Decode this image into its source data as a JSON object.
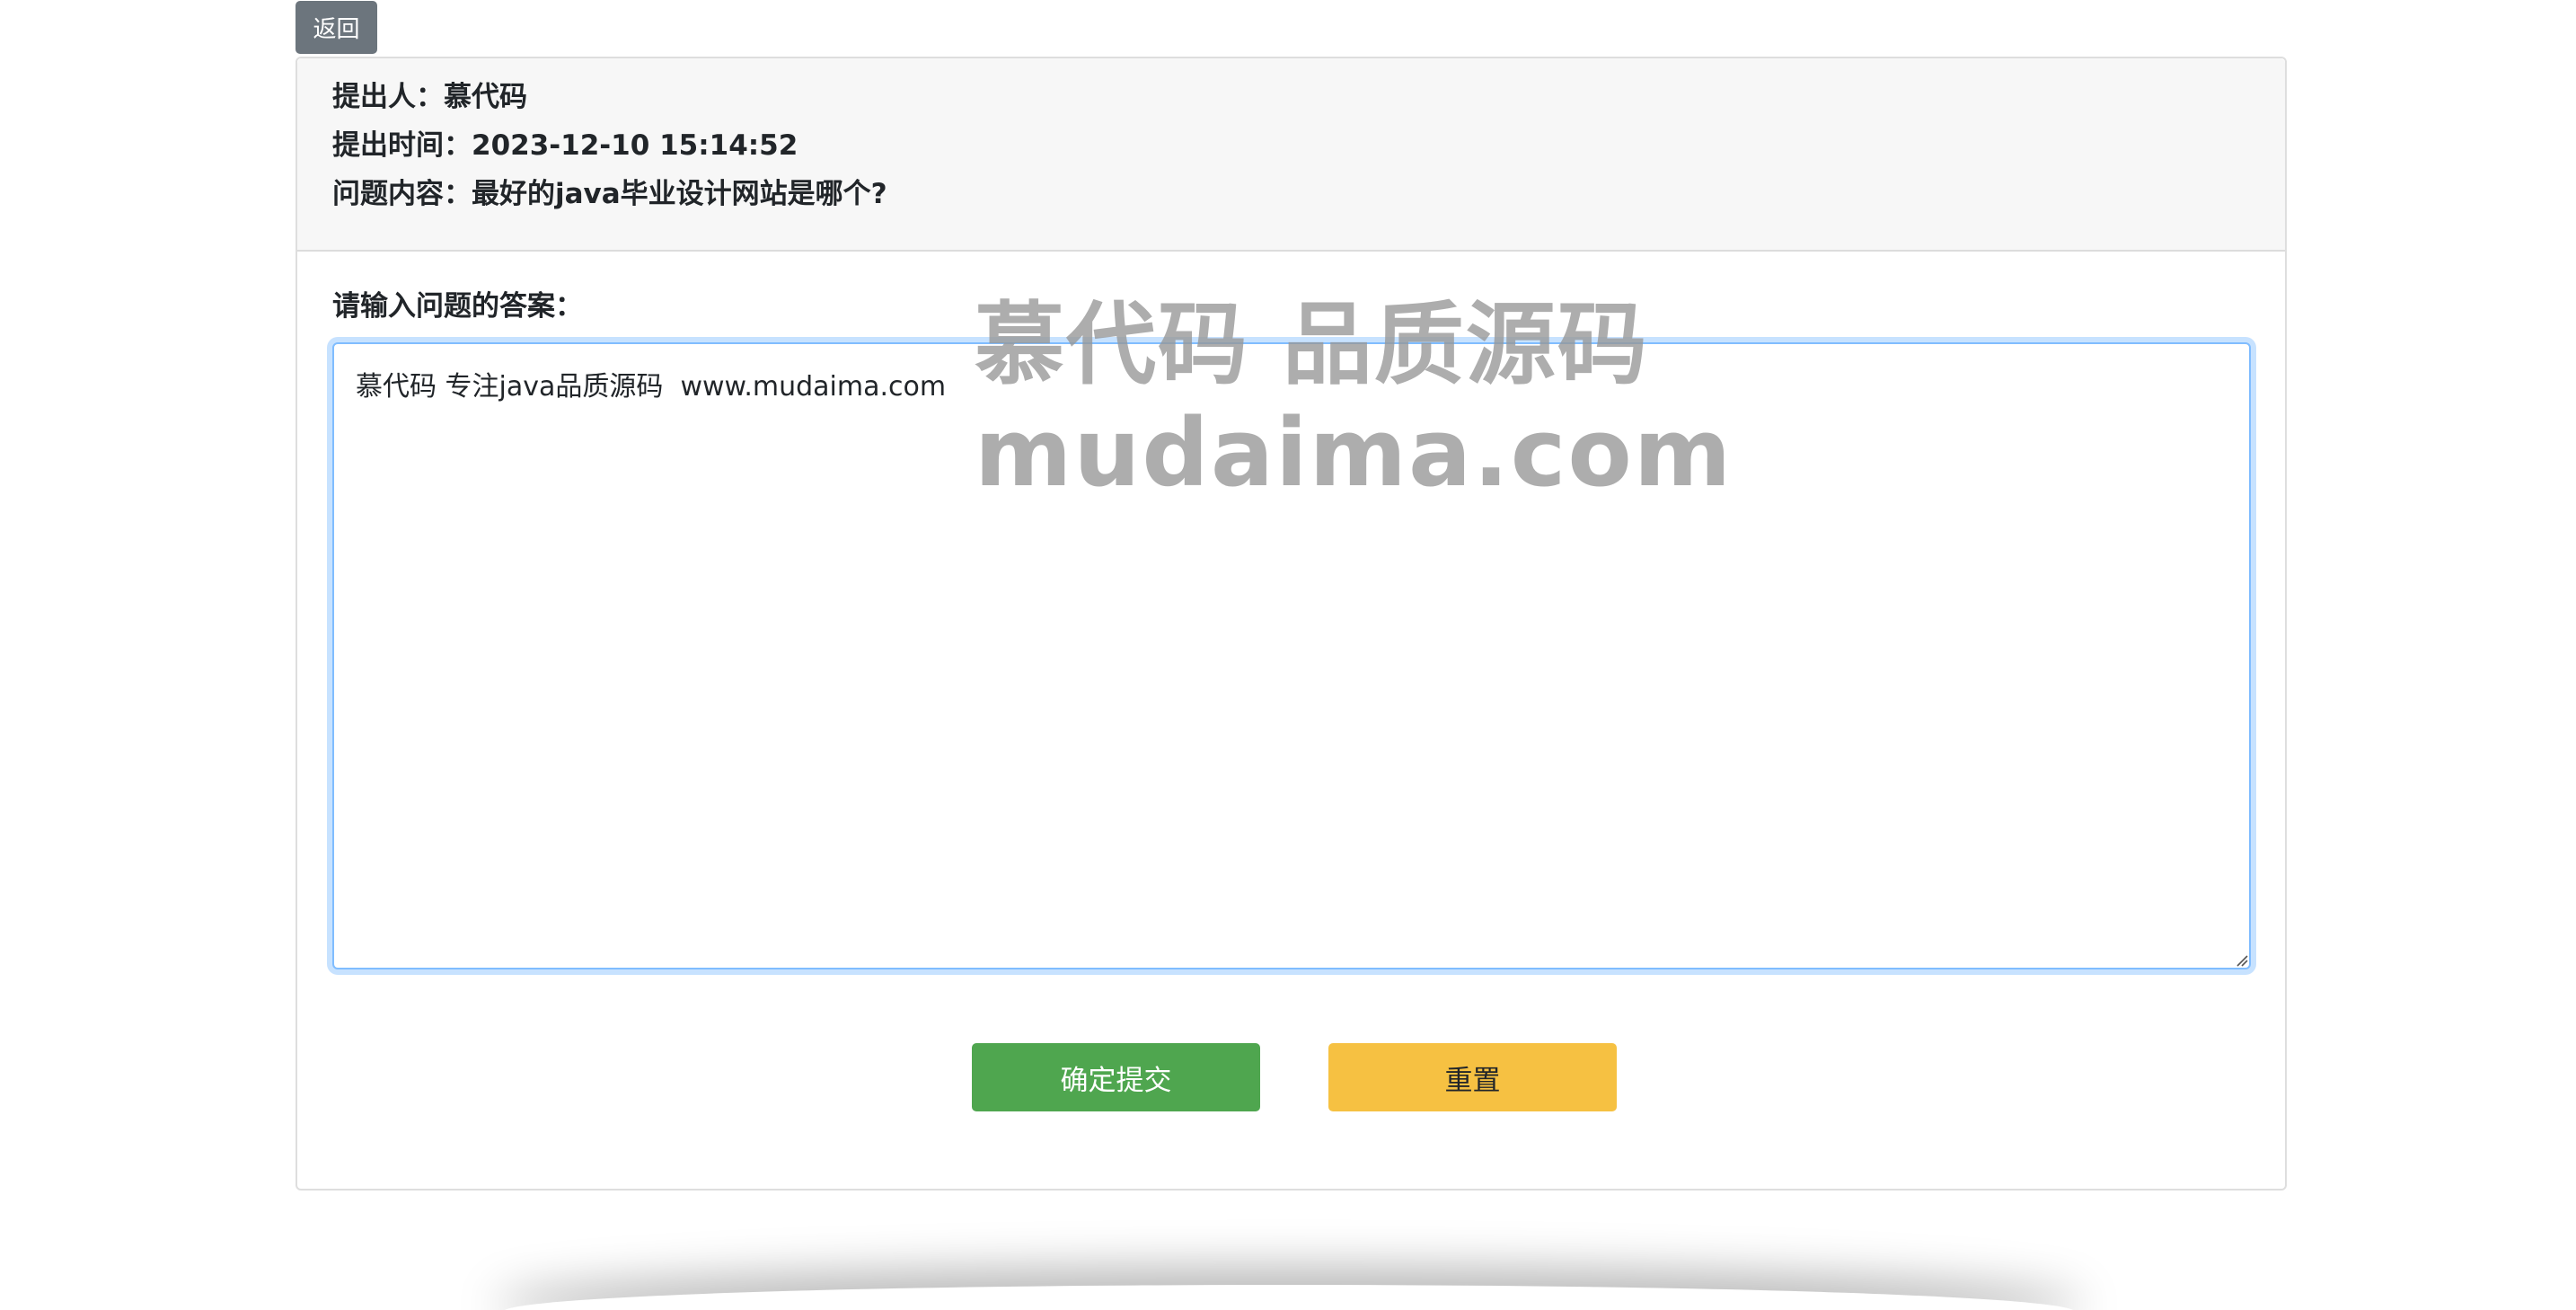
{
  "nav": {
    "back_label": "返回"
  },
  "question": {
    "author_line": "提出人：慕代码",
    "time_line": "提出时间：2023-12-10 15:14:52",
    "content_line": "问题内容：最好的java毕业设计网站是哪个?"
  },
  "answer": {
    "label": "请输入问题的答案：",
    "value": "慕代码 专注java品质源码  www.mudaima.com"
  },
  "actions": {
    "submit_label": "确定提交",
    "reset_label": "重置"
  },
  "watermark": {
    "line1": "慕代码 品质源码",
    "line2": "mudaima.com"
  },
  "colors": {
    "back_button": "#6c757d",
    "submit_button": "#4fa64f",
    "reset_button": "#f6c142",
    "textarea_focus_border": "#80bdff",
    "header_background": "#f7f7f7"
  }
}
